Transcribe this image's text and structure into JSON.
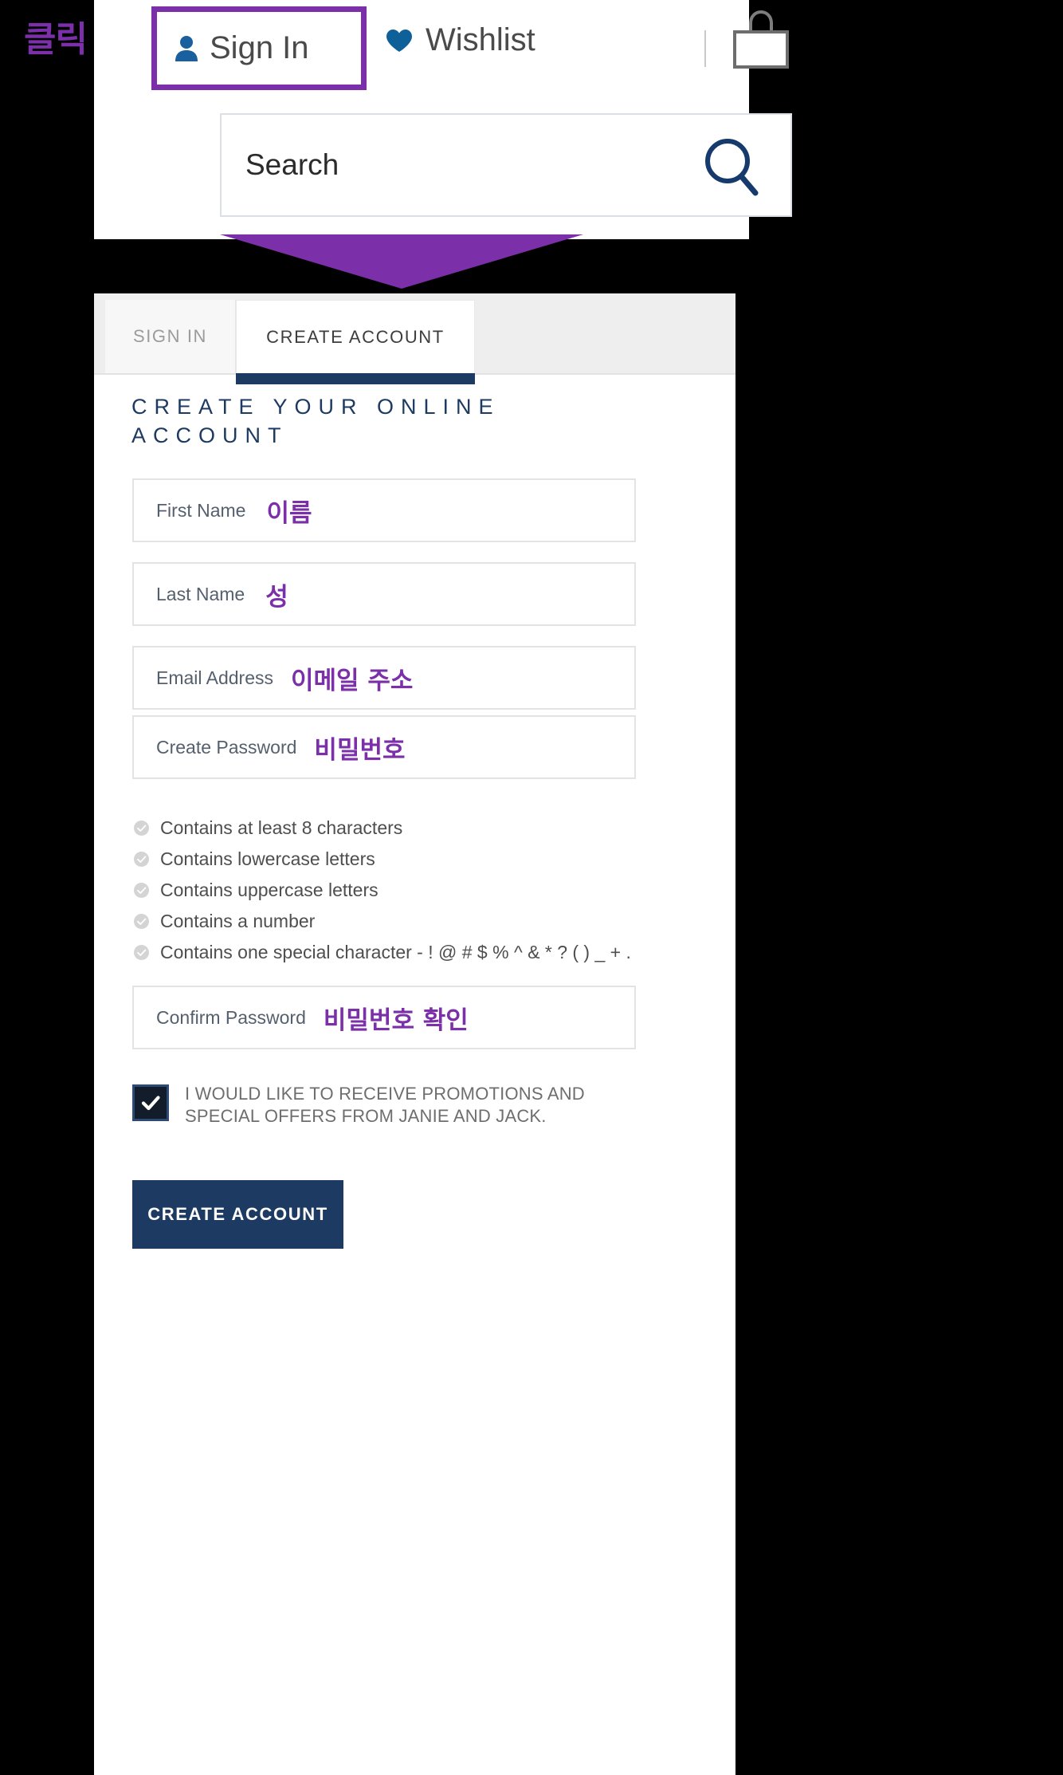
{
  "annotation": {
    "click_label": "클릭",
    "arrow_color": "#7b2fa8"
  },
  "header": {
    "signin": {
      "label": "Sign In",
      "icon": "person-icon"
    },
    "wishlist": {
      "label": "Wishlist",
      "icon": "heart-icon"
    },
    "bag": {
      "icon": "shopping-bag-icon"
    },
    "search": {
      "placeholder": "Search",
      "icon": "search-icon"
    }
  },
  "account_panel": {
    "tabs": [
      {
        "label": "SIGN IN",
        "active": false
      },
      {
        "label": "CREATE ACCOUNT",
        "active": true
      }
    ],
    "heading": "CREATE YOUR ONLINE ACCOUNT",
    "fields": [
      {
        "label": "First Name",
        "hint": "이름"
      },
      {
        "label": "Last Name",
        "hint": "성"
      },
      {
        "label": "Email Address",
        "hint": "이메일 주소"
      },
      {
        "label": "Create Password",
        "hint": "비밀번호"
      },
      {
        "label": "Confirm Password",
        "hint": "비밀번호 확인"
      }
    ],
    "password_requirements": [
      "Contains at least 8 characters",
      "Contains lowercase letters",
      "Contains uppercase letters",
      "Contains a number",
      "Contains one special character - ! @ # $ % ^ & * ? ( ) _ + ."
    ],
    "promotions_checkbox": {
      "checked": true,
      "label_line1": "I WOULD LIKE TO RECEIVE PROMOTIONS AND",
      "label_line2": "SPECIAL OFFERS FROM JANIE AND JACK."
    },
    "submit_label": "CREATE ACCOUNT"
  },
  "colors": {
    "accent_purple": "#7b2fa8",
    "brand_navy": "#1d3b62",
    "icon_blue": "#1a5f9e"
  }
}
